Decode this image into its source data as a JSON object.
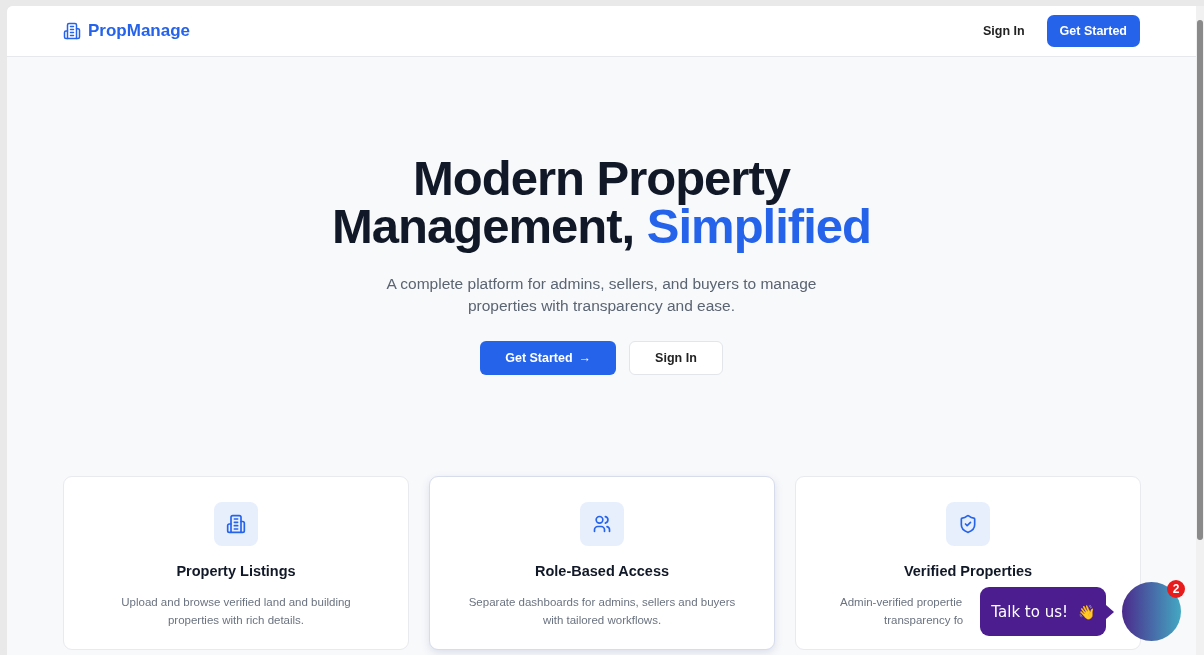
{
  "header": {
    "brand": "PropManage",
    "links": [
      {
        "label": "Sign In",
        "kind": "link"
      },
      {
        "label": "Get Started",
        "kind": "primary"
      }
    ]
  },
  "hero": {
    "title_line1": "Modern Property",
    "title_line2": "Management,",
    "title_highlight": "Simplified",
    "subtitle": "A complete platform for admins, sellers, and buyers to manage properties with transparency and ease.",
    "buttons": [
      {
        "label": "Get Started",
        "kind": "primary",
        "arrow": "→"
      },
      {
        "label": "Sign In",
        "kind": "outline"
      }
    ]
  },
  "features": [
    {
      "kind": "building",
      "title": "Property Listings",
      "description": [
        "Upload and browse verified land and building",
        "properties with rich details."
      ],
      "hovered": false,
      "covered": false
    },
    {
      "kind": "users",
      "title": "Role-Based Access",
      "description": [
        "Separate dashboards for admins, sellers and buyers",
        "with tailored workflows."
      ],
      "hovered": true,
      "covered": false
    },
    {
      "kind": "shield",
      "title": "Verified Properties",
      "description": [
        "Admin-verified propertie",
        "transparency fo"
      ],
      "hovered": false,
      "covered": true
    }
  ],
  "chat": {
    "prompt": "Talk to us!",
    "emoji": "👋",
    "badge": "2"
  }
}
